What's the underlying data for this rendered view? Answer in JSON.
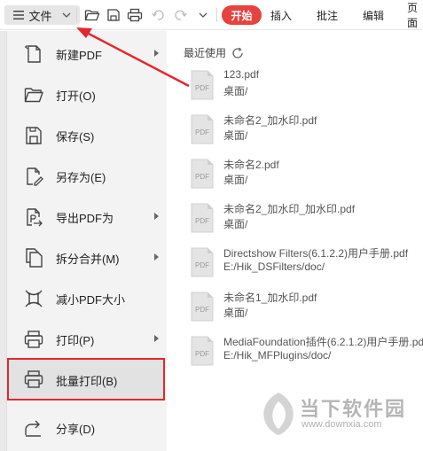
{
  "toolbar": {
    "file_menu_label": "文件",
    "tabs": [
      "开始",
      "插入",
      "批注",
      "编辑",
      "页面"
    ]
  },
  "menu": {
    "items": [
      {
        "label": "新建PDF",
        "icon": "new-pdf-icon",
        "submenu": true
      },
      {
        "label": "打开(O)",
        "icon": "folder-open-icon",
        "submenu": false
      },
      {
        "label": "保存(S)",
        "icon": "save-icon",
        "submenu": false
      },
      {
        "label": "另存为(E)",
        "icon": "save-as-icon",
        "submenu": false
      },
      {
        "label": "导出PDF为",
        "icon": "export-pdf-icon",
        "submenu": true
      },
      {
        "label": "拆分合并(M)",
        "icon": "split-merge-icon",
        "submenu": true
      },
      {
        "label": "减小PDF大小",
        "icon": "compress-icon",
        "submenu": false
      },
      {
        "label": "打印(P)",
        "icon": "print-icon",
        "submenu": true
      },
      {
        "label": "批量打印(B)",
        "icon": "batch-print-icon",
        "submenu": false,
        "selected": true
      },
      {
        "label": "分享(D)",
        "icon": "share-icon",
        "submenu": false
      }
    ]
  },
  "recent": {
    "title": "最近使用",
    "files": [
      {
        "name": "123.pdf",
        "path": "桌面/"
      },
      {
        "name": "未命名2_加水印.pdf",
        "path": "桌面/"
      },
      {
        "name": "未命名2.pdf",
        "path": "桌面/"
      },
      {
        "name": "未命名2_加水印_加水印.pdf",
        "path": "桌面/"
      },
      {
        "name": "Directshow Filters(6.1.2.2)用户手册.pdf",
        "path": "E:/Hik_DSFilters/doc/"
      },
      {
        "name": "未命名1_加水印.pdf",
        "path": "桌面/"
      },
      {
        "name": "MediaFoundation插件(6.2.1.2)用户手册.pdf",
        "path": "E:/Hik_MFPlugins/doc/"
      }
    ],
    "pdf_badge": "PDF"
  },
  "watermark": {
    "brand": "当下软件园",
    "url": "www.downxia.com"
  },
  "colors": {
    "accent_red": "#e8423f",
    "highlight_border": "#e0292f",
    "menu_bg": "#f3f3f3"
  }
}
